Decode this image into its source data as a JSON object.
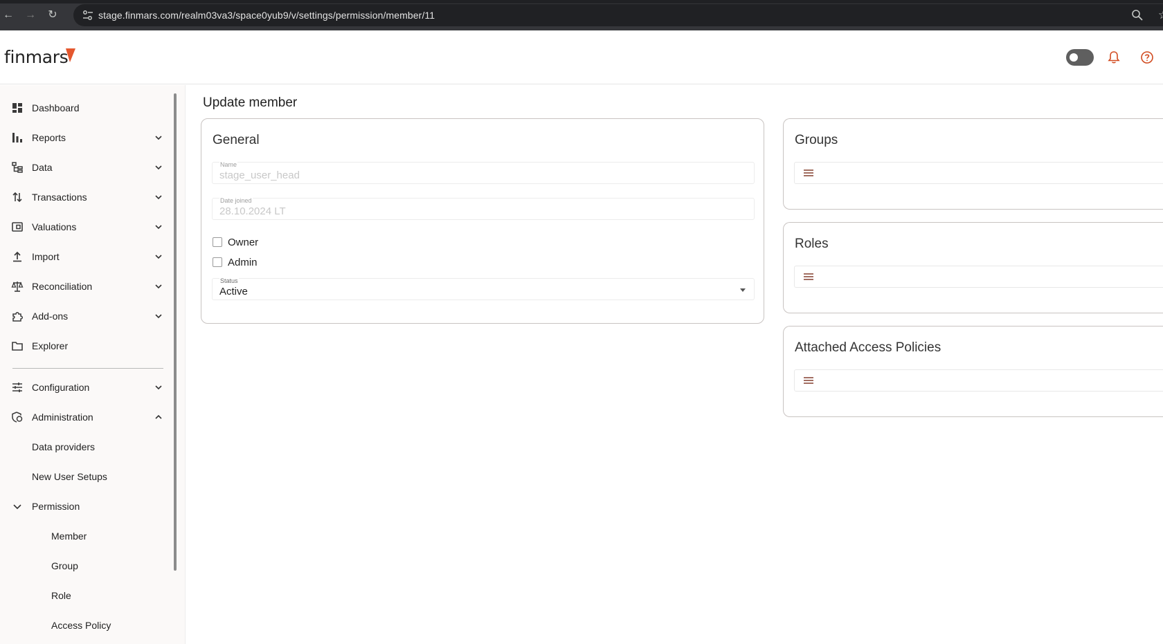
{
  "browser": {
    "url": "stage.finmars.com/realm03va3/space0yub9/v/settings/permission/member/11"
  },
  "header": {
    "logo_text": "finmars",
    "accent": "#e4572e"
  },
  "sidebar": {
    "items": [
      {
        "label": "Dashboard"
      },
      {
        "label": "Reports"
      },
      {
        "label": "Data"
      },
      {
        "label": "Transactions"
      },
      {
        "label": "Valuations"
      },
      {
        "label": "Import"
      },
      {
        "label": "Reconciliation"
      },
      {
        "label": "Add-ons"
      },
      {
        "label": "Explorer"
      },
      {
        "label": "Configuration"
      },
      {
        "label": "Administration"
      }
    ],
    "admin_sub": [
      {
        "label": "Data providers"
      },
      {
        "label": "New User Setups"
      },
      {
        "label": "Permission"
      }
    ],
    "permission_sub": [
      {
        "label": "Member"
      },
      {
        "label": "Group"
      },
      {
        "label": "Role"
      },
      {
        "label": "Access Policy"
      }
    ]
  },
  "main": {
    "title": "Update member",
    "general": {
      "title": "General",
      "name_label": "Name",
      "name_value": "stage_user_head",
      "date_label": "Date joined",
      "date_value": "28.10.2024 LT",
      "owner_label": "Owner",
      "admin_label": "Admin",
      "status_label": "Status",
      "status_value": "Active"
    },
    "groups": {
      "title": "Groups"
    },
    "roles": {
      "title": "Roles"
    },
    "policies": {
      "title": "Attached Access Policies"
    }
  }
}
